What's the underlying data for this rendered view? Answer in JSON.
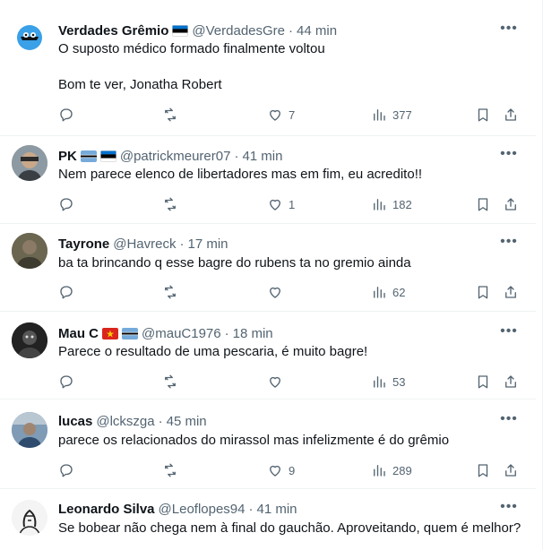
{
  "tweets": [
    {
      "name": "Verdades Grêmio",
      "handle": "@VerdadesGre",
      "time": "44 min",
      "text": "O suposto médico formado finalmente voltou",
      "text2": "Bom te ver, Jonatha Robert",
      "likes": "7",
      "views": "377",
      "replies": "",
      "retweets": ""
    },
    {
      "name": "PK",
      "handle": "@patrickmeurer07",
      "time": "41 min",
      "text": "Nem parece elenco de libertadores mas em fim, eu acredito!!",
      "likes": "1",
      "views": "182"
    },
    {
      "name": "Tayrone",
      "handle": "@Havreck",
      "time": "17 min",
      "text": "ba ta brincando q esse bagre do rubens ta no gremio ainda",
      "likes": "",
      "views": "62"
    },
    {
      "name": "Mau C",
      "handle": "@mauC1976",
      "time": "18 min",
      "text": "Parece o resultado de uma pescaria, é muito bagre!",
      "likes": "",
      "views": "53"
    },
    {
      "name": "lucas",
      "handle": "@lckszga",
      "time": "45 min",
      "text": "parece os relacionados do mirassol mas infelizmente é do grêmio",
      "likes": "9",
      "views": "289"
    },
    {
      "name": "Leonardo Silva",
      "handle": "@Leoflopes94",
      "time": "41 min",
      "text": "Se bobear não chega nem à final do gauchão. Aproveitando, quem é melhor?"
    }
  ],
  "separator": "·",
  "icons": [
    "reply-icon",
    "retweet-icon",
    "like-icon",
    "views-icon",
    "bookmark-icon",
    "share-icon",
    "more-icon"
  ],
  "colors": {
    "secondary_text": "#536471",
    "primary_text": "#0f1419",
    "divider": "#eff3f4"
  }
}
